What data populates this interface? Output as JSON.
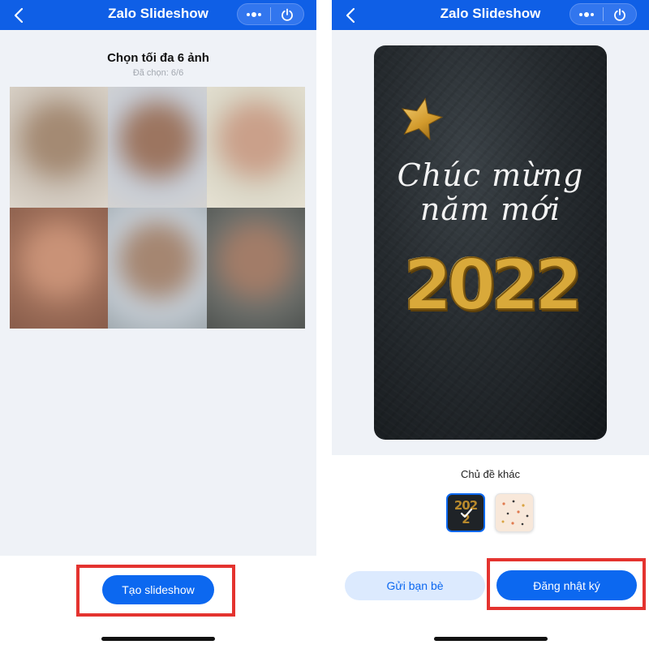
{
  "left": {
    "header": {
      "title": "Zalo Slideshow"
    },
    "picker": {
      "title": "Chọn tối đa 6 ảnh",
      "count": "Đã chọn: 6/6"
    },
    "photos": [
      {
        "colors": [
          "#ccc3b8",
          "#a48a73",
          "#e8e2d8"
        ]
      },
      {
        "colors": [
          "#c7cdd6",
          "#9c7560",
          "#dcd5cc"
        ]
      },
      {
        "colors": [
          "#d9d6c6",
          "#caa08a",
          "#efe9dc"
        ]
      },
      {
        "colors": [
          "#9c6d58",
          "#c99277",
          "#7a5040"
        ]
      },
      {
        "colors": [
          "#c4ccd4",
          "#a58671",
          "#8a9498"
        ]
      },
      {
        "colors": [
          "#6b6e6a",
          "#a27c68",
          "#3e4240"
        ]
      }
    ],
    "create_button": "Tạo slideshow"
  },
  "right": {
    "header": {
      "title": "Zalo Slideshow"
    },
    "card": {
      "line1": "Chúc mừng",
      "line2": "năm mới",
      "year": "2022"
    },
    "themes_label": "Chủ đề khác",
    "thumb_dark_text": "2022",
    "send_button": "Gửi bạn bè",
    "post_button": "Đăng nhật ký"
  },
  "colors": {
    "header": "#0f5fe6",
    "primary_button": "#0c68f0",
    "secondary_button": "#dceafe",
    "highlight": "#e4332f",
    "content_bg": "#eff2f7"
  }
}
